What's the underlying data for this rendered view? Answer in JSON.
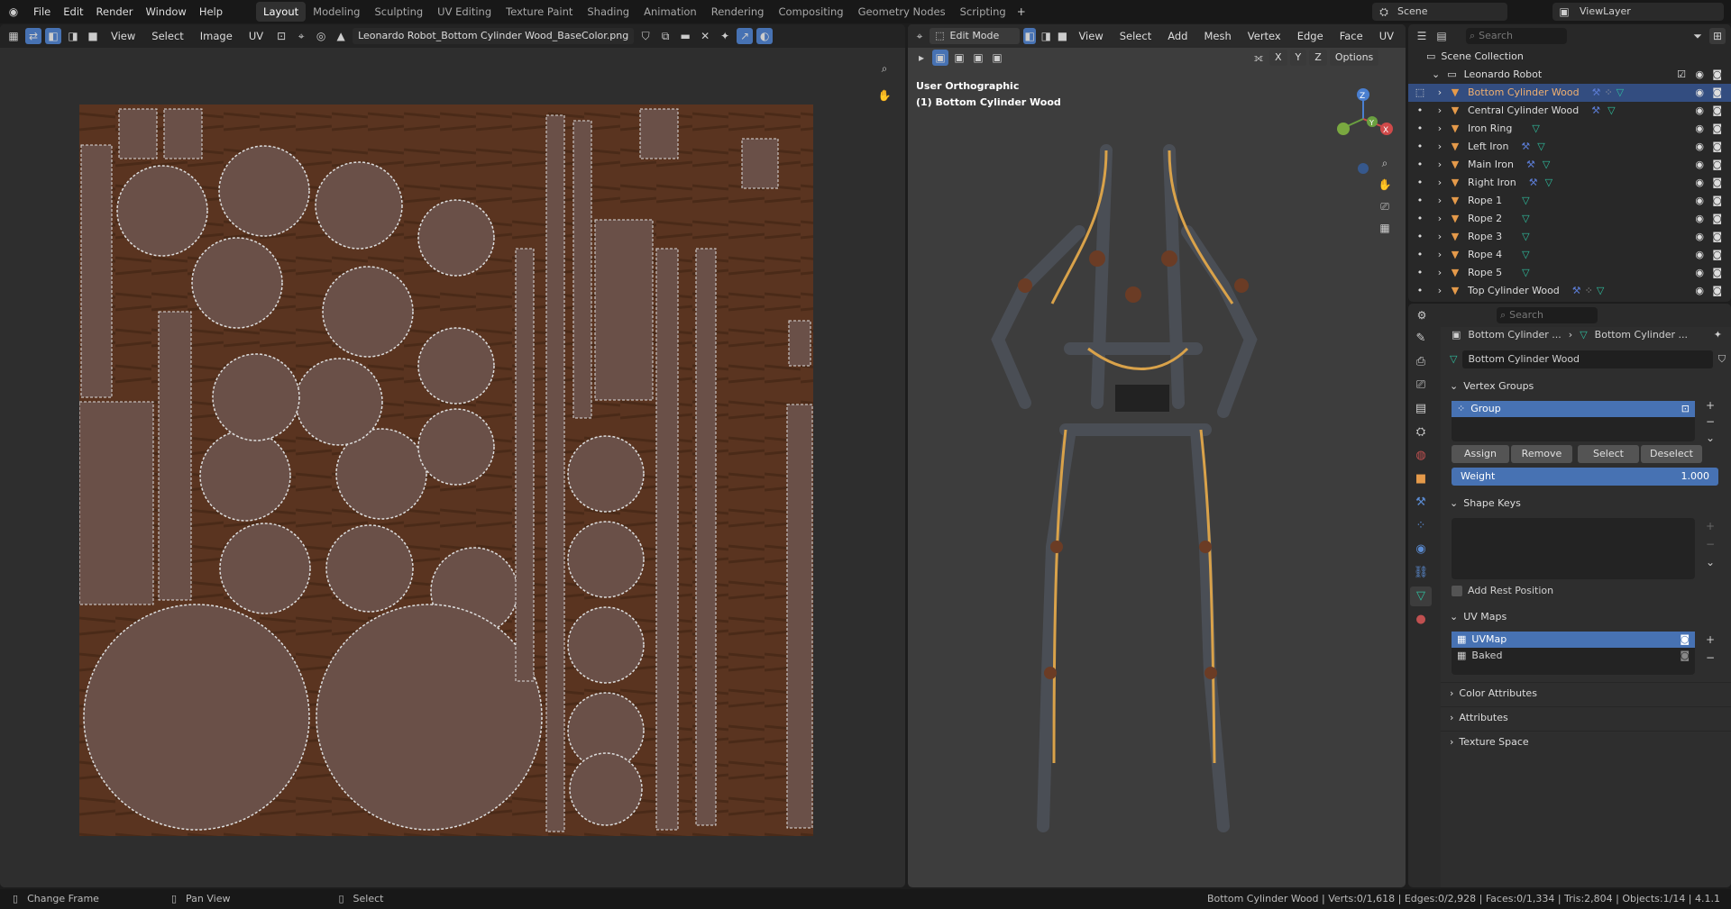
{
  "topbar": {
    "menus": [
      "File",
      "Edit",
      "Render",
      "Window",
      "Help"
    ],
    "workspaces": [
      "Layout",
      "Modeling",
      "Sculpting",
      "UV Editing",
      "Texture Paint",
      "Shading",
      "Animation",
      "Rendering",
      "Compositing",
      "Geometry Nodes",
      "Scripting"
    ],
    "active_workspace": "Layout",
    "scene": "Scene",
    "view_layer": "ViewLayer"
  },
  "uv_editor": {
    "menus": [
      "View",
      "Select",
      "Image",
      "UV"
    ],
    "image_name": "Leonardo Robot_Bottom Cylinder Wood_BaseColor.png"
  },
  "viewport": {
    "mode": "Edit Mode",
    "menus": [
      "View",
      "Select",
      "Add",
      "Mesh",
      "Vertex",
      "Edge",
      "Face",
      "UV"
    ],
    "axes": [
      "X",
      "Y",
      "Z"
    ],
    "options_label": "Options",
    "view_name": "User Orthographic",
    "object_label": "(1) Bottom Cylinder Wood",
    "gizmo": {
      "x": "X",
      "y": "Y",
      "z": "Z"
    }
  },
  "outliner": {
    "search_placeholder": "Search",
    "scene_collection": "Scene Collection",
    "collection": "Leonardo Robot",
    "objects": [
      {
        "name": "Bottom Cylinder Wood",
        "modifier": true,
        "material": true,
        "selected": true
      },
      {
        "name": "Central Cylinder Wood",
        "modifier": true,
        "material": false
      },
      {
        "name": "Iron Ring",
        "modifier": false,
        "material": false
      },
      {
        "name": "Left Iron",
        "modifier": true,
        "material": false
      },
      {
        "name": "Main Iron",
        "modifier": true,
        "material": false
      },
      {
        "name": "Right Iron",
        "modifier": true,
        "material": false
      },
      {
        "name": "Rope 1",
        "modifier": false,
        "material": false
      },
      {
        "name": "Rope 2",
        "modifier": false,
        "material": false
      },
      {
        "name": "Rope 3",
        "modifier": false,
        "material": false
      },
      {
        "name": "Rope 4",
        "modifier": false,
        "material": false
      },
      {
        "name": "Rope 5",
        "modifier": false,
        "material": false
      },
      {
        "name": "Top Cylinder Wood",
        "modifier": true,
        "material": true
      }
    ]
  },
  "properties": {
    "search_placeholder": "Search",
    "breadcrumb": [
      "Bottom Cylinder ...",
      "Bottom Cylinder ..."
    ],
    "mesh_name": "Bottom Cylinder Wood",
    "vertex_groups": {
      "title": "Vertex Groups",
      "items": [
        "Group"
      ],
      "assign": "Assign",
      "remove": "Remove",
      "select": "Select",
      "deselect": "Deselect",
      "weight_label": "Weight",
      "weight_value": "1.000"
    },
    "shape_keys": {
      "title": "Shape Keys",
      "add_rest_position": "Add Rest Position"
    },
    "uv_maps": {
      "title": "UV Maps",
      "items": [
        "UVMap",
        "Baked"
      ]
    },
    "collapsed": [
      "Color Attributes",
      "Attributes",
      "Texture Space"
    ]
  },
  "status": {
    "left": [
      {
        "icon": "mouse-left",
        "label": "Change Frame"
      },
      {
        "icon": "mouse-middle",
        "label": "Pan View"
      },
      {
        "icon": "mouse-right",
        "label": "Select"
      }
    ],
    "right": "Bottom Cylinder Wood | Verts:0/1,618 | Edges:0/2,928 | Faces:0/1,334 | Tris:2,804 | Objects:1/14 | 4.1.1"
  },
  "colors": {
    "accent": "#4772b3",
    "selected_row": "#334d80",
    "object_icon": "#e59a4a",
    "mesh_icon": "#2fbf9f",
    "wood": "#5a3420"
  }
}
